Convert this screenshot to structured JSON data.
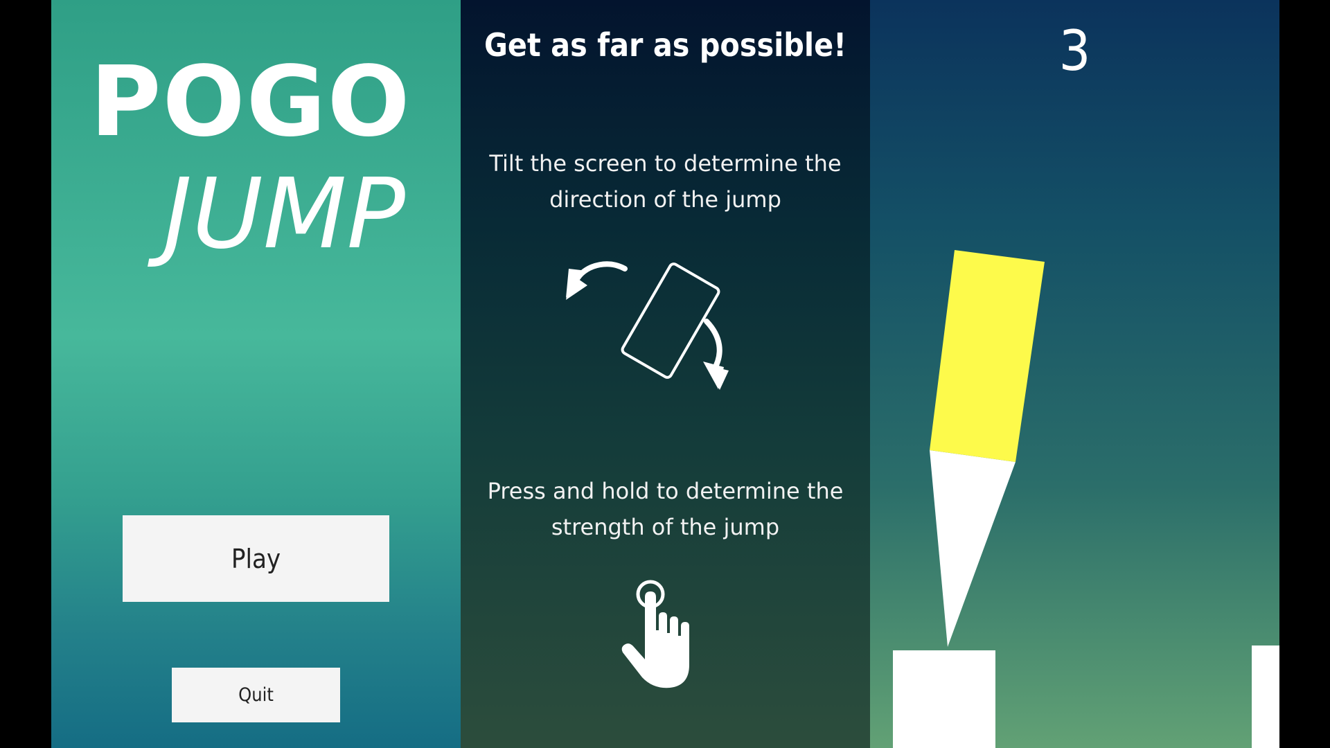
{
  "menu": {
    "logo_line1": "POGO",
    "logo_line2": "JUMP",
    "play_label": "Play",
    "quit_label": "Quit"
  },
  "instructions": {
    "title": "Get as far as possible!",
    "tilt_text": "Tilt the screen to determine the direction of the jump",
    "press_text": "Press and hold to determine the strength of the jump"
  },
  "game": {
    "score": "3"
  },
  "colors": {
    "menu_bg": "#47b89b",
    "instructions_bg": "#082a36",
    "game_bg": "#145066",
    "pogo_body": "#fdfa4b",
    "button_bg": "#f4f4f4",
    "platform": "#ffffff"
  },
  "icons": {
    "tilt": "tilt-phone-icon",
    "tap": "tap-hand-icon"
  }
}
